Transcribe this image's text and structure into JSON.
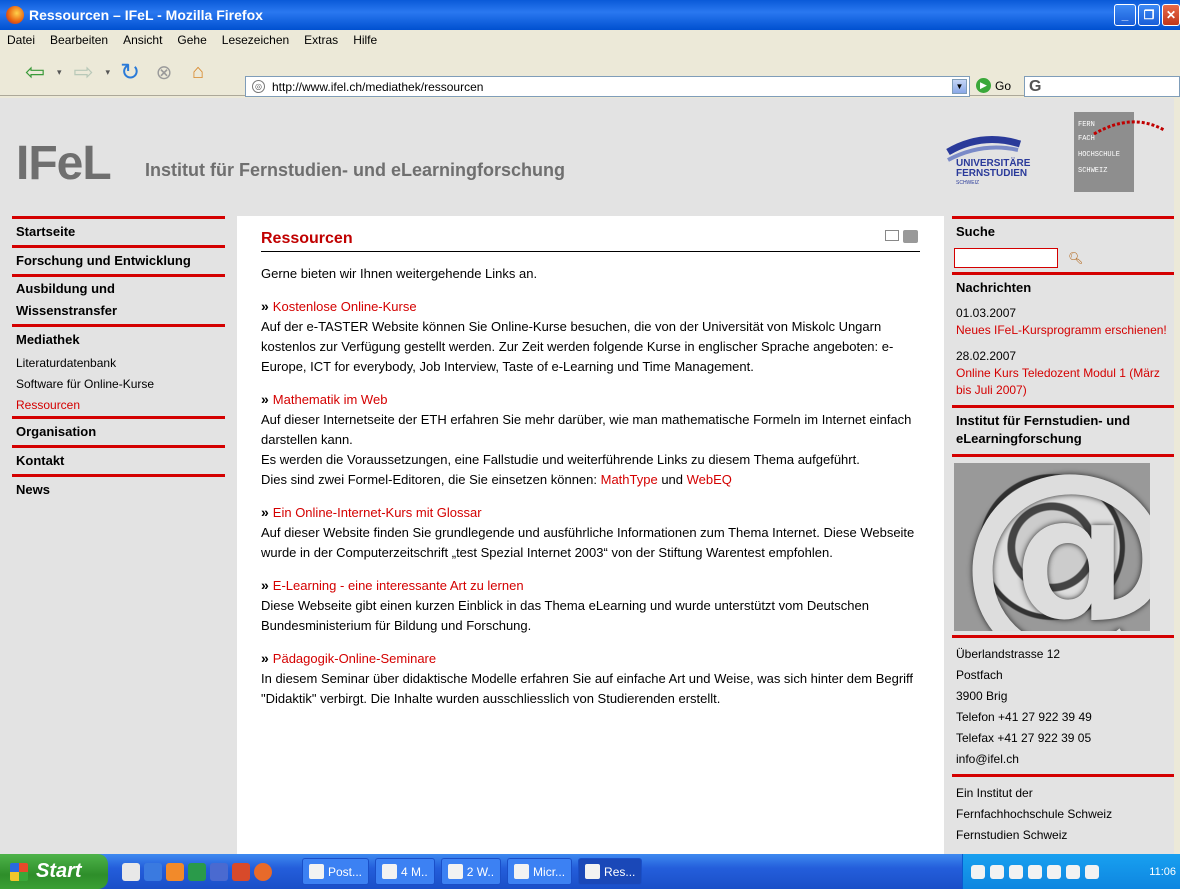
{
  "window": {
    "title": "Ressourcen – IFeL - Mozilla Firefox"
  },
  "menu": [
    "Datei",
    "Bearbeiten",
    "Ansicht",
    "Gehe",
    "Lesezeichen",
    "Extras",
    "Hilfe"
  ],
  "toolbar": {
    "url": "http://www.ifel.ch/mediathek/ressourcen",
    "go_label": "Go",
    "search_glyph": "G"
  },
  "header": {
    "logo": "IFeL",
    "tagline": "Institut für Fernstudien- und eLearningforschung",
    "partner_lines": [
      "UNIVERSITÄRE",
      "FERNSTUDIEN",
      "SCHWEIZ"
    ],
    "partner_right": [
      "FERN",
      "FACH",
      "HOCHSCHULE",
      "SCHWEIZ"
    ]
  },
  "leftnav": {
    "items": [
      {
        "label": "Startseite"
      },
      {
        "label": "Forschung und Entwicklung"
      },
      {
        "label": "Ausbildung und"
      },
      {
        "label": "Wissenstransfer"
      },
      {
        "label": "Mediathek"
      }
    ],
    "sub": [
      {
        "label": "Literaturdatenbank"
      },
      {
        "label": "Software für Online-Kurse"
      },
      {
        "label": "Ressourcen"
      }
    ],
    "items2": [
      {
        "label": "Organisation"
      },
      {
        "label": "Kontakt"
      },
      {
        "label": "News"
      }
    ]
  },
  "content": {
    "title": "Ressourcen",
    "intro": "Gerne bieten wir Ihnen weitergehende Links an.",
    "resources": [
      {
        "link": "Kostenlose Online-Kurse",
        "text": "Auf der e-TASTER Website können Sie Online-Kurse besuchen, die von der Universität von Miskolc Ungarn kostenlos zur Verfügung gestellt werden. Zur Zeit werden folgende Kurse in englischer Sprache angeboten: e-Europe, ICT for everybody, Job Interview, Taste of e-Learning und Time Management."
      },
      {
        "link": "Mathematik im Web",
        "text": "Auf dieser Internetseite der ETH erfahren Sie mehr darüber, wie man mathematische Formeln im Internet einfach darstellen kann.",
        "text2": "Es werden die Voraussetzungen, eine Fallstudie und weiterführende Links zu diesem Thema aufgeführt.",
        "text3": "Dies sind zwei Formel-Editoren, die Sie einsetzen können: ",
        "link_a": "MathType",
        "joiner": " und ",
        "link_b": "WebEQ"
      },
      {
        "link": "Ein Online-Internet-Kurs mit Glossar",
        "text": "Auf dieser Website finden Sie grundlegende und ausführliche Informationen zum Thema Internet. Diese Webseite wurde in der Computerzeitschrift „test Spezial Internet 2003“ von der Stiftung Warentest empfohlen."
      },
      {
        "link": "E-Learning - eine interessante Art zu lernen",
        "text": "Diese Webseite gibt einen kurzen Einblick in das Thema eLearning und wurde unterstützt vom Deutschen Bundesministerium für Bildung und Forschung."
      },
      {
        "link": "Pädagogik-Online-Seminare",
        "text": "In diesem Seminar über didaktische Modelle erfahren Sie auf einfache Art und Weise, was sich hinter dem Begriff \"Didaktik\" verbirgt. Die Inhalte wurden ausschliesslich von Studierenden erstellt."
      }
    ]
  },
  "rightcol": {
    "search_title": "Suche",
    "news_title": "Nachrichten",
    "news": [
      {
        "date": "01.03.2007",
        "link": "Neues IFeL-Kursprogramm erschienen!"
      },
      {
        "date": "28.02.2007",
        "link": "Online Kurs Teledozent Modul 1 (März bis Juli 2007)"
      }
    ],
    "inst_title": "Institut für Fernstudien- und eLearningforschung",
    "address": [
      "Überlandstrasse 12",
      "Postfach",
      "3900 Brig",
      "Telefon +41 27 922 39 49",
      "Telefax +41 27 922 39 05",
      "info@ifel.ch"
    ],
    "footer": [
      "Ein Institut der",
      "Fernfachhochschule Schweiz",
      "Fernstudien Schweiz"
    ]
  },
  "taskbar": {
    "start": "Start",
    "buttons": [
      "Post...",
      "4 M..",
      "2 W..",
      "Micr...",
      "Res..."
    ],
    "clock": "11:06"
  },
  "colors": {
    "accent": "#d40000",
    "page_bg": "#e3e3e3",
    "xp_blue": "#245edb"
  }
}
